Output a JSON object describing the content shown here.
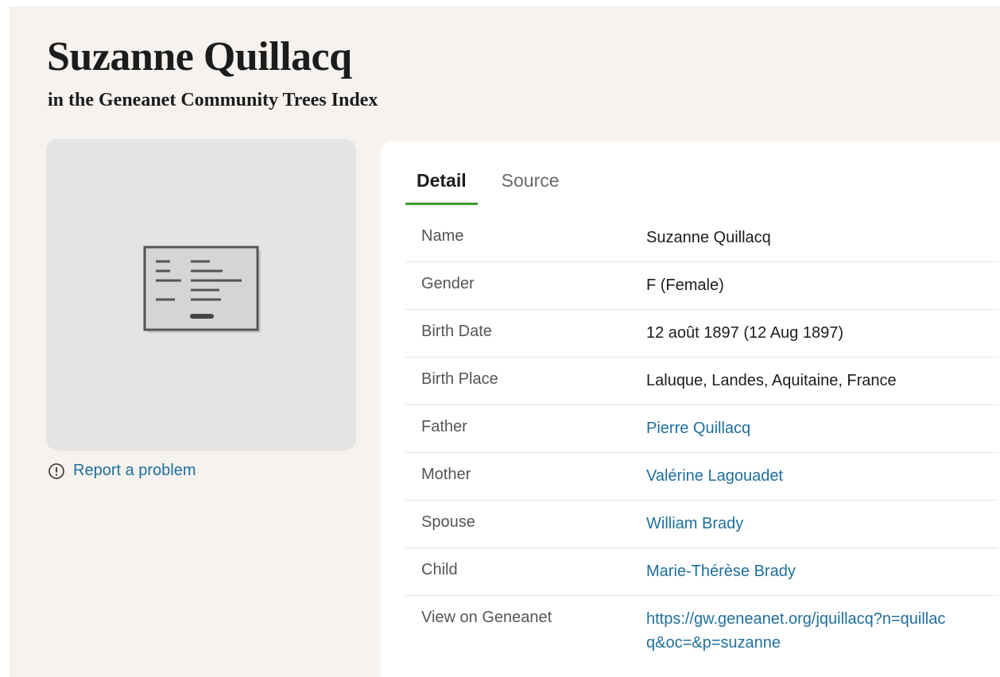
{
  "header": {
    "title": "Suzanne Quillacq",
    "subtitle": "in the Geneanet Community Trees Index"
  },
  "sidebar": {
    "image_icon": "document-icon",
    "report_label": "Report a problem",
    "report_icon": "info-circle-icon"
  },
  "tabs": [
    {
      "label": "Detail",
      "active": true
    },
    {
      "label": "Source",
      "active": false
    }
  ],
  "details": [
    {
      "label": "Name",
      "value": "Suzanne Quillacq"
    },
    {
      "label": "Gender",
      "value": "F (Female)"
    },
    {
      "label": "Birth Date",
      "value": "12 août 1897 (12 Aug 1897)"
    },
    {
      "label": "Birth Place",
      "value": "Laluque, Landes, Aquitaine, France"
    },
    {
      "label": "Father",
      "value": "Pierre Quillacq"
    },
    {
      "label": "Mother",
      "value": "Valérine Lagouadet"
    },
    {
      "label": "Spouse",
      "value": "William Brady"
    },
    {
      "label": "Child",
      "value": "Marie-Thérèse Brady"
    },
    {
      "label": "View on Geneanet",
      "value": "https://gw.geneanet.org/jquillacq?n=quillacq&oc=&p=suzanne"
    }
  ],
  "colors": {
    "link": "#1f6f9b",
    "tab_underline": "#3c9a2d",
    "page_bg": "#f5f2ef"
  }
}
